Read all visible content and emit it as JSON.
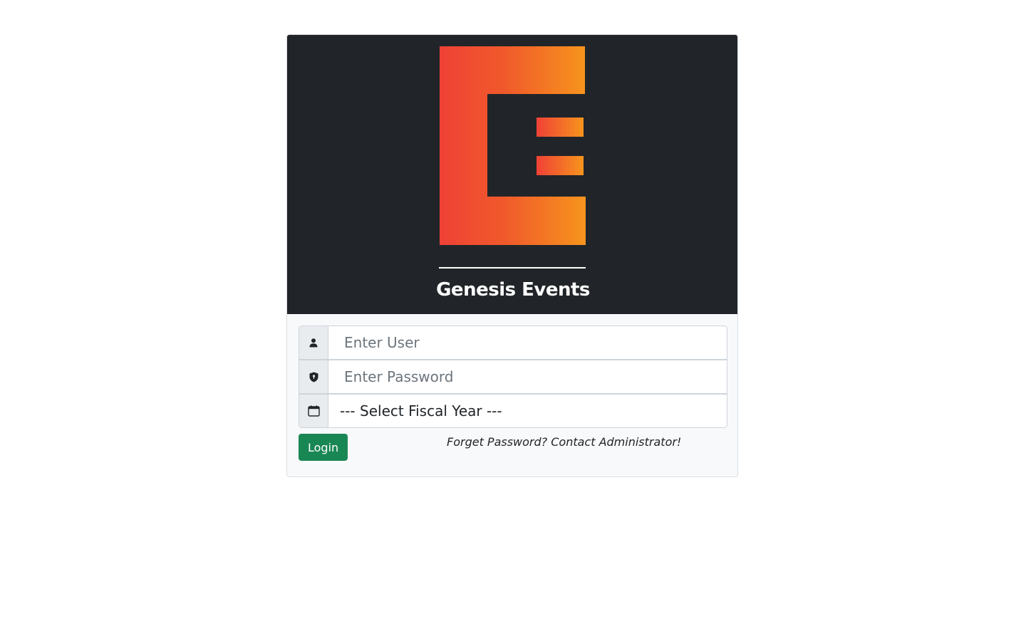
{
  "brand": {
    "name": "Genesis Events",
    "logo": "genesis-e-logo",
    "gradient_start": "#ef4136",
    "gradient_end": "#f7941d",
    "banner_bg": "#212529"
  },
  "form": {
    "user": {
      "placeholder": "Enter User",
      "value": "",
      "icon": "user-icon"
    },
    "password": {
      "placeholder": "Enter Password",
      "value": "",
      "icon": "shield-icon"
    },
    "fiscal_year": {
      "selected": "--- Select Fiscal Year ---",
      "icon": "calendar-icon"
    },
    "login_label": "Login",
    "forget_text": "Forget Password? Contact Administrator!"
  },
  "colors": {
    "login_button": "#198754",
    "card_bg": "#f8f9fa"
  }
}
